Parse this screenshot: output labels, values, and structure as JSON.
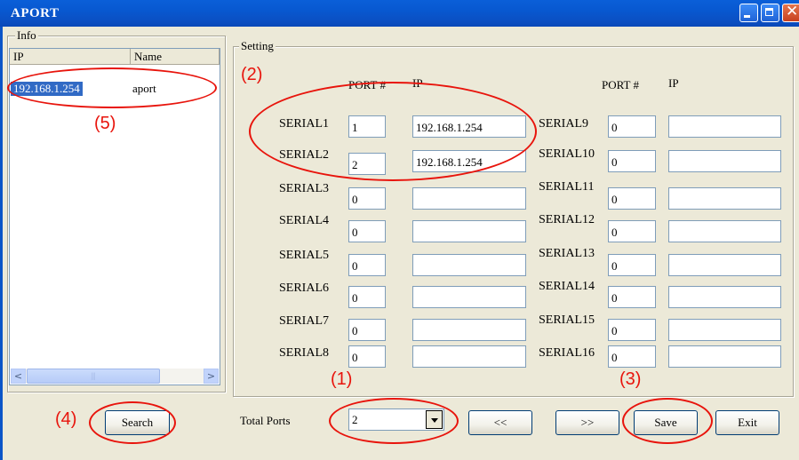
{
  "window": {
    "title": "APORT"
  },
  "info": {
    "group_label": "Info",
    "columns": [
      "IP",
      "Name"
    ],
    "rows": [
      {
        "ip": "192.168.1.254",
        "name": "aport"
      }
    ]
  },
  "setting": {
    "group_label": "Setting",
    "header_port": "PORT #",
    "header_ip": "IP",
    "left": [
      {
        "label": "SERIAL1",
        "port": "1",
        "ip": "192.168.1.254"
      },
      {
        "label": "SERIAL2",
        "port": "2",
        "ip": "192.168.1.254"
      },
      {
        "label": "SERIAL3",
        "port": "0",
        "ip": ""
      },
      {
        "label": "SERIAL4",
        "port": "0",
        "ip": ""
      },
      {
        "label": "SERIAL5",
        "port": "0",
        "ip": ""
      },
      {
        "label": "SERIAL6",
        "port": "0",
        "ip": ""
      },
      {
        "label": "SERIAL7",
        "port": "0",
        "ip": ""
      },
      {
        "label": "SERIAL8",
        "port": "0",
        "ip": ""
      }
    ],
    "right": [
      {
        "label": "SERIAL9",
        "port": "0",
        "ip": ""
      },
      {
        "label": "SERIAL10",
        "port": "0",
        "ip": ""
      },
      {
        "label": "SERIAL11",
        "port": "0",
        "ip": ""
      },
      {
        "label": "SERIAL12",
        "port": "0",
        "ip": ""
      },
      {
        "label": "SERIAL13",
        "port": "0",
        "ip": ""
      },
      {
        "label": "SERIAL14",
        "port": "0",
        "ip": ""
      },
      {
        "label": "SERIAL15",
        "port": "0",
        "ip": ""
      },
      {
        "label": "SERIAL16",
        "port": "0",
        "ip": ""
      }
    ]
  },
  "bottom": {
    "search_label": "Search",
    "total_ports_label": "Total Ports",
    "total_ports_value": "2",
    "prev_label": "<<",
    "next_label": ">>",
    "save_label": "Save",
    "exit_label": "Exit"
  },
  "annotations": [
    "(1)",
    "(2)",
    "(3)",
    "(4)",
    "(5)"
  ],
  "colors": {
    "annotation": "#e8140c",
    "titlebar": "#0a5fd8",
    "selection": "#316ac5"
  }
}
